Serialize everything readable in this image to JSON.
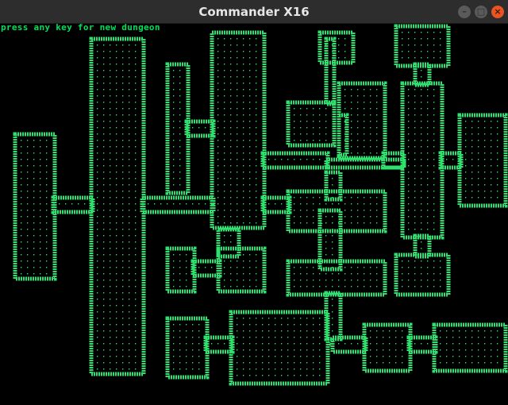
{
  "window": {
    "title": "Commander X16",
    "controls": {
      "minimize": "–",
      "maximize": "□",
      "close": "×"
    }
  },
  "screen": {
    "message": "press any key for new dungeon",
    "colors": {
      "wall": "#2ee06e",
      "floor": "#2ee06e",
      "background": "#000000"
    },
    "glyphs": {
      "wall": "#",
      "floor": ".",
      "door": "+"
    }
  }
}
